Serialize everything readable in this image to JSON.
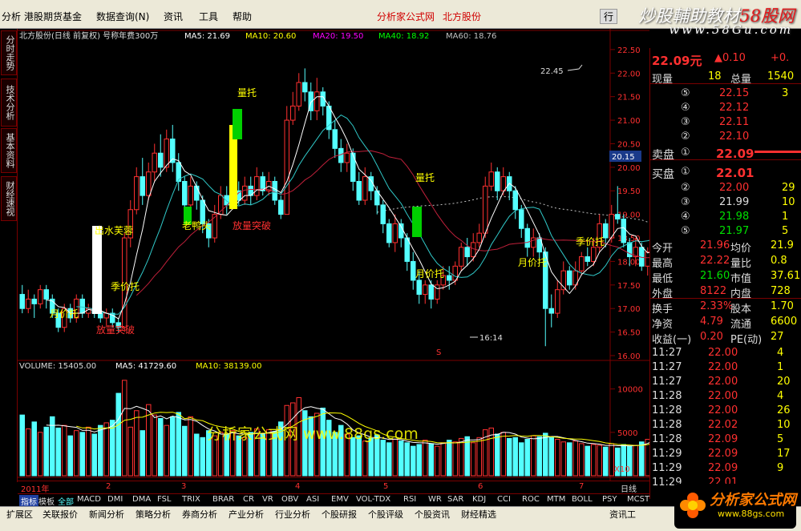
{
  "menu": {
    "items": [
      "分析",
      "港股期货基金",
      "数据查询(N)",
      "资讯",
      "工具",
      "帮助"
    ],
    "center_a": "分析家公式网",
    "center_b": "北方股份",
    "right_btn": "行"
  },
  "site": {
    "logo_a": "炒股輔助教材",
    "logo_b": "58股网",
    "url": "www.58Gu.com"
  },
  "left_tabs": [
    "分时走势",
    "技术分析",
    "基本资料",
    "财经速视"
  ],
  "chart_header": {
    "title": "北方股份(日线 前复权) 号称年费300万",
    "ma5": "MA5: 21.69",
    "ma10": "MA10: 20.60",
    "ma20": "MA20: 19.50",
    "ma40": "MA40: 18.92",
    "ma60": "MA60: 18.76"
  },
  "volume_header": {
    "vol": "VOLUME: 15405.00",
    "ma5": "MA5: 41729.60",
    "ma10": "MA10: 38139.00"
  },
  "annotations": {
    "a1": "量托",
    "a2": "放量突破",
    "a3": "季价托",
    "a4": "月价托",
    "a5": "放量突破",
    "a6": "老鸭头",
    "a7": "量托",
    "a8": "出水芙蓉",
    "a9": "月价托",
    "a10": "季价托",
    "a11": "月价托",
    "high_label": "22.45",
    "low_label": "16:14",
    "watermark": "分析家公式网 www.88gs.com",
    "marker_s": "S",
    "price_tag": "20.15"
  },
  "axes": {
    "price_ticks": [
      "22.50",
      "22.00",
      "21.50",
      "21.00",
      "20.50",
      "20.00",
      "19.50",
      "19.00",
      "18.50",
      "18.00",
      "17.50",
      "17.00",
      "16.50",
      "16.00"
    ],
    "volume_ticks": [
      "10000",
      "5000"
    ],
    "vol_unit": "X10",
    "year": "2011年",
    "months": [
      "2",
      "3",
      "4",
      "5",
      "6",
      "7"
    ],
    "right_label": "日线"
  },
  "chart_data": {
    "type": "candlestick",
    "title": "北方股份(日线 前复权) 号称年费300万",
    "ylim": [
      16.0,
      22.6
    ],
    "volume_ylim": [
      0,
      12000
    ],
    "months": [
      "2",
      "3",
      "4",
      "5",
      "6",
      "7"
    ],
    "ma_values": {
      "MA5": 21.69,
      "MA10": 20.6,
      "MA20": 19.5,
      "MA40": 18.92,
      "MA60": 18.76
    },
    "candles": [
      [
        17.3,
        17.0,
        17.5,
        16.9,
        7000
      ],
      [
        17.0,
        17.2,
        17.4,
        16.9,
        5400
      ],
      [
        17.2,
        17.1,
        17.3,
        16.8,
        6200
      ],
      [
        17.1,
        17.4,
        17.5,
        17.0,
        5000
      ],
      [
        17.4,
        17.2,
        17.5,
        17.0,
        5600
      ],
      [
        17.2,
        16.9,
        17.3,
        16.8,
        6800
      ],
      [
        16.9,
        16.6,
        17.0,
        16.5,
        5500
      ],
      [
        16.6,
        17.0,
        17.1,
        16.5,
        5800
      ],
      [
        17.0,
        16.8,
        17.1,
        16.7,
        4600
      ],
      [
        16.8,
        17.2,
        17.3,
        16.7,
        5200
      ],
      [
        17.2,
        16.9,
        17.3,
        16.8,
        5000
      ],
      [
        16.9,
        17.0,
        17.1,
        16.8,
        5600
      ],
      [
        17.0,
        16.9,
        17.1,
        16.8,
        4800
      ],
      [
        16.9,
        16.8,
        17.0,
        16.7,
        5800
      ],
      [
        16.8,
        16.9,
        17.0,
        16.6,
        6100
      ],
      [
        16.9,
        16.7,
        17.0,
        16.6,
        6400
      ],
      [
        16.7,
        16.6,
        16.8,
        16.5,
        9500
      ],
      [
        16.6,
        18.5,
        18.6,
        16.5,
        11000
      ],
      [
        18.5,
        19.1,
        19.3,
        18.3,
        5600
      ],
      [
        19.1,
        19.8,
        20.0,
        19.0,
        7500
      ],
      [
        19.8,
        19.4,
        20.2,
        19.2,
        5200
      ],
      [
        19.4,
        19.9,
        20.1,
        19.3,
        8200
      ],
      [
        19.9,
        20.3,
        20.5,
        19.7,
        7000
      ],
      [
        20.3,
        20.0,
        20.7,
        19.8,
        6600
      ],
      [
        20.0,
        20.6,
        20.8,
        19.9,
        5800
      ],
      [
        20.6,
        20.1,
        20.9,
        19.9,
        6800
      ],
      [
        20.1,
        19.7,
        20.3,
        19.5,
        7300
      ],
      [
        19.7,
        19.2,
        19.8,
        19.0,
        5700
      ],
      [
        19.2,
        19.6,
        19.8,
        19.1,
        6800
      ],
      [
        19.6,
        19.3,
        19.7,
        19.1,
        4800
      ],
      [
        19.3,
        18.8,
        19.4,
        18.6,
        4400
      ],
      [
        18.8,
        18.5,
        18.9,
        18.3,
        5200
      ],
      [
        18.5,
        19.0,
        19.2,
        18.4,
        4600
      ],
      [
        19.0,
        19.4,
        19.6,
        18.9,
        5000
      ],
      [
        19.4,
        19.2,
        19.6,
        19.0,
        4800
      ],
      [
        19.2,
        19.5,
        19.7,
        19.1,
        5200
      ],
      [
        19.5,
        19.3,
        19.7,
        19.2,
        4600
      ],
      [
        19.3,
        19.6,
        19.8,
        19.2,
        4400
      ],
      [
        19.6,
        19.4,
        19.8,
        19.2,
        5000
      ],
      [
        19.4,
        19.8,
        20.0,
        19.3,
        5400
      ],
      [
        19.8,
        19.5,
        19.9,
        19.4,
        4800
      ],
      [
        19.5,
        19.7,
        19.9,
        19.4,
        5300
      ],
      [
        19.7,
        19.3,
        19.8,
        19.2,
        5100
      ],
      [
        19.3,
        19.0,
        19.4,
        18.9,
        6200
      ],
      [
        19.0,
        21.0,
        21.3,
        19.0,
        8100
      ],
      [
        21.0,
        21.3,
        21.6,
        20.9,
        8400
      ],
      [
        21.3,
        21.8,
        22.0,
        21.2,
        9000
      ],
      [
        21.8,
        21.6,
        22.1,
        21.4,
        7500
      ],
      [
        21.6,
        21.2,
        21.8,
        21.0,
        6800
      ],
      [
        21.2,
        21.6,
        21.9,
        21.0,
        7200
      ],
      [
        21.6,
        21.3,
        21.7,
        21.1,
        7800
      ],
      [
        21.3,
        20.8,
        21.4,
        20.6,
        6400
      ],
      [
        20.8,
        20.4,
        21.0,
        20.2,
        5000
      ],
      [
        20.4,
        20.1,
        20.6,
        19.9,
        5800
      ],
      [
        20.1,
        20.3,
        20.5,
        19.9,
        4800
      ],
      [
        20.3,
        19.7,
        20.4,
        19.5,
        4400
      ],
      [
        19.7,
        19.3,
        19.9,
        19.2,
        4600
      ],
      [
        19.3,
        19.8,
        20.0,
        19.2,
        4000
      ],
      [
        19.8,
        19.5,
        19.9,
        19.3,
        4300
      ],
      [
        19.5,
        19.2,
        19.6,
        19.0,
        4700
      ],
      [
        19.2,
        18.8,
        19.3,
        18.6,
        4100
      ],
      [
        18.8,
        18.4,
        18.9,
        18.3,
        3800
      ],
      [
        18.4,
        18.8,
        19.0,
        18.2,
        4200
      ],
      [
        18.8,
        18.5,
        18.9,
        18.3,
        4000
      ],
      [
        18.5,
        18.0,
        18.6,
        17.8,
        3800
      ],
      [
        18.0,
        17.6,
        18.2,
        17.4,
        3400
      ],
      [
        17.6,
        17.3,
        17.8,
        17.1,
        3600
      ],
      [
        17.3,
        17.5,
        17.6,
        17.1,
        4100
      ],
      [
        17.5,
        17.2,
        17.6,
        17.0,
        3700
      ],
      [
        17.2,
        17.5,
        17.6,
        17.1,
        3400
      ],
      [
        17.5,
        17.7,
        17.9,
        17.4,
        3800
      ],
      [
        17.7,
        17.6,
        17.9,
        17.4,
        4100
      ],
      [
        17.6,
        17.9,
        18.0,
        17.5,
        3900
      ],
      [
        17.9,
        18.3,
        18.4,
        17.8,
        4300
      ],
      [
        18.3,
        18.1,
        18.5,
        17.9,
        4500
      ],
      [
        18.1,
        18.4,
        18.6,
        18.0,
        3800
      ],
      [
        18.4,
        18.6,
        18.8,
        18.3,
        4400
      ],
      [
        18.6,
        19.6,
        19.8,
        18.5,
        5300
      ],
      [
        19.6,
        19.9,
        20.1,
        19.5,
        5500
      ],
      [
        19.9,
        19.5,
        20.0,
        19.3,
        4800
      ],
      [
        19.5,
        19.8,
        20.0,
        19.4,
        5000
      ],
      [
        19.8,
        19.5,
        19.9,
        19.3,
        4300
      ],
      [
        19.5,
        19.1,
        19.6,
        18.9,
        4400
      ],
      [
        19.1,
        18.7,
        19.2,
        18.5,
        3800
      ],
      [
        18.7,
        18.3,
        18.8,
        18.1,
        4200
      ],
      [
        18.3,
        18.5,
        18.7,
        18.1,
        4600
      ],
      [
        18.5,
        18.2,
        18.6,
        18.0,
        4500
      ],
      [
        18.2,
        17.0,
        18.3,
        16.2,
        4900
      ],
      [
        17.0,
        16.9,
        17.3,
        16.6,
        4400
      ],
      [
        16.9,
        17.4,
        17.6,
        16.8,
        4200
      ],
      [
        17.4,
        17.8,
        18.0,
        17.3,
        3900
      ],
      [
        17.8,
        17.5,
        17.9,
        17.4,
        3800
      ],
      [
        17.5,
        17.8,
        18.0,
        17.4,
        4000
      ],
      [
        17.8,
        18.1,
        18.2,
        17.7,
        3700
      ],
      [
        18.1,
        18.0,
        18.3,
        17.9,
        3400
      ],
      [
        18.0,
        18.3,
        18.5,
        17.9,
        3600
      ],
      [
        18.3,
        18.8,
        19.0,
        18.2,
        3500
      ],
      [
        18.8,
        18.5,
        18.9,
        18.3,
        3300
      ],
      [
        18.5,
        19.0,
        19.2,
        18.4,
        3700
      ],
      [
        19.0,
        18.9,
        19.6,
        18.8,
        3200
      ],
      [
        18.9,
        18.4,
        19.0,
        18.3,
        3600
      ],
      [
        18.4,
        18.1,
        18.5,
        17.9,
        3400
      ],
      [
        18.1,
        18.3,
        18.5,
        17.9,
        3500
      ],
      [
        18.3,
        17.9,
        18.4,
        17.8,
        3900
      ],
      [
        17.9,
        18.2,
        18.3,
        17.7,
        4200
      ],
      [
        18.2,
        18.6,
        18.8,
        18.1,
        5300
      ],
      [
        18.6,
        19.2,
        19.4,
        18.5,
        5500
      ],
      [
        19.2,
        19.8,
        20.0,
        19.1,
        6000
      ],
      [
        19.8,
        20.4,
        20.6,
        19.7,
        6800
      ],
      [
        20.4,
        21.0,
        21.2,
        20.3,
        7500
      ],
      [
        21.0,
        21.6,
        21.8,
        20.9,
        8600
      ],
      [
        21.6,
        22.3,
        22.45,
        21.5,
        7200
      ],
      [
        22.3,
        21.9,
        22.4,
        21.7,
        6000
      ],
      [
        21.9,
        22.2,
        22.3,
        21.8,
        5400
      ],
      [
        22.2,
        22.09,
        22.3,
        21.8,
        2200
      ]
    ]
  },
  "quote": {
    "price": "22.09元",
    "change": "▲0.10",
    "change_right": "+0.",
    "r1": [
      "现量",
      "18",
      "总量",
      "1540"
    ],
    "ask": [
      [
        "⑤",
        "22.15",
        "3"
      ],
      [
        "④",
        "22.12",
        ""
      ],
      [
        "③",
        "22.11",
        ""
      ],
      [
        "②",
        "22.10",
        ""
      ]
    ],
    "sell1": [
      "卖盘",
      "①",
      "22.09"
    ],
    "buy1": [
      "买盘",
      "①",
      "22.01"
    ],
    "bid": [
      [
        "②",
        "22.00",
        "29"
      ],
      [
        "③",
        "21.99",
        "10"
      ],
      [
        "④",
        "21.98",
        "1"
      ],
      [
        "⑤",
        "21.97",
        "5"
      ]
    ],
    "stats": [
      [
        "今开",
        "21.96",
        "均价",
        "21.9"
      ],
      [
        "最高",
        "22.22",
        "量比",
        "0.8"
      ],
      [
        "最低",
        "21.60",
        "市值",
        "37.61"
      ],
      [
        "外盘",
        "8122",
        "内盘",
        "728"
      ],
      [
        "换手",
        "2.33%",
        "股本",
        "1.70"
      ],
      [
        "净资",
        "4.79",
        "流通",
        "6600"
      ],
      [
        "收益(一)",
        "0.20",
        "PE(动)",
        "27"
      ]
    ],
    "ticks": [
      [
        "11:27",
        "22.00",
        "4"
      ],
      [
        "11:27",
        "22.00",
        "1"
      ],
      [
        "11:27",
        "22.00",
        "20"
      ],
      [
        "11:28",
        "22.00",
        "4"
      ],
      [
        "11:28",
        "22.00",
        "26"
      ],
      [
        "11:28",
        "22.02",
        "10"
      ],
      [
        "11:28",
        "22.09",
        "5"
      ],
      [
        "11:29",
        "22.09",
        "17"
      ],
      [
        "11:29",
        "22.09",
        "9"
      ],
      [
        "11:29",
        "22.01",
        ""
      ]
    ]
  },
  "indicator_tabs": [
    "指标",
    "模板",
    "全部",
    "MACD",
    "DMI",
    "DMA",
    "FSL",
    "TRIX",
    "BRAR",
    "CR",
    "VR",
    "OBV",
    "ASI",
    "EMV",
    "VOL-TDX",
    "RSI",
    "WR",
    "SAR",
    "KDJ",
    "CCI",
    "ROC",
    "MTM",
    "BOLL",
    "PSY",
    "MCST"
  ],
  "footer_tabs": [
    "扩展区",
    "关联报价",
    "新闻分析",
    "策略分析",
    "券商分析",
    "产业分析",
    "行业分析",
    "个股研报",
    "个股评级",
    "个股资讯",
    "财经精选"
  ],
  "footer_right": "资讯工",
  "brand": {
    "name": "分析家公式网",
    "url": "www.88gs.com"
  },
  "colors": {
    "up": "#ff3030",
    "down": "#54ffff",
    "ma5": "#ffffff",
    "ma10": "#ffff00",
    "ma20": "#ff00ff",
    "ma40": "#00ff00",
    "ma60": "#c0c0c0",
    "grid": "#7a0000"
  }
}
